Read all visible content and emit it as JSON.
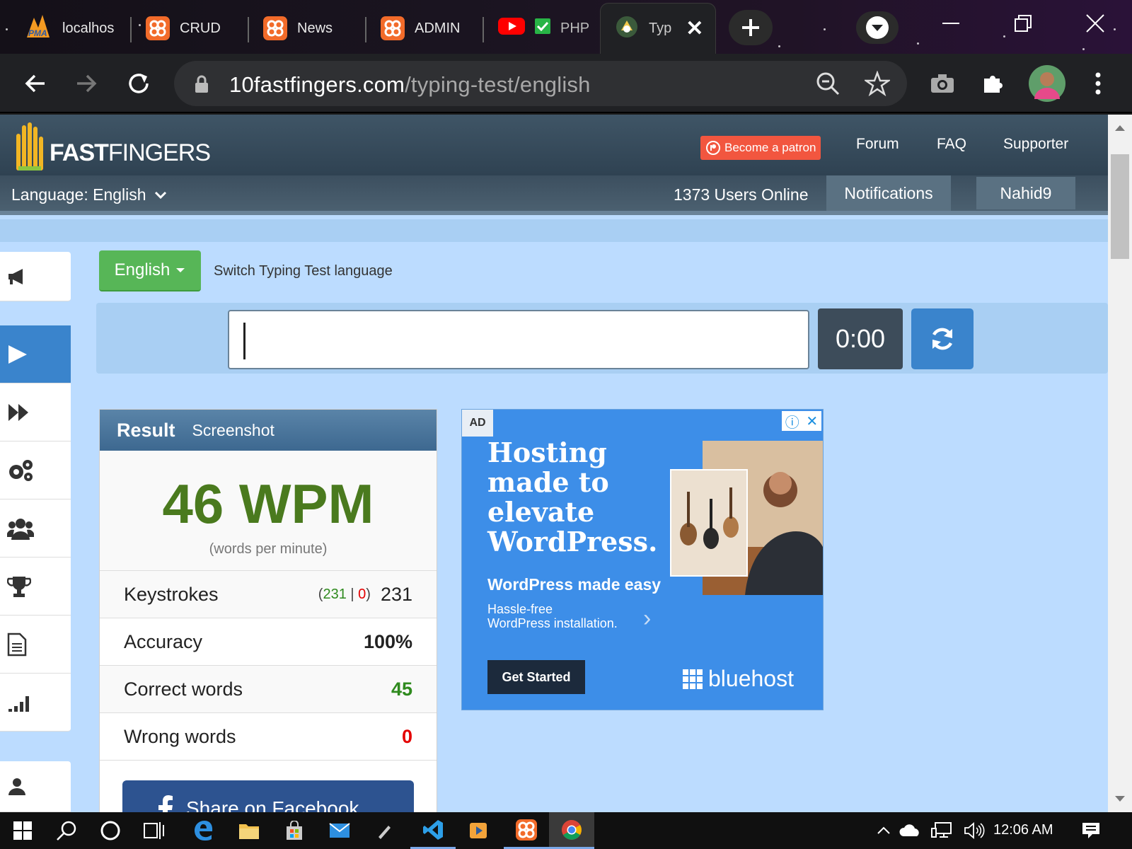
{
  "browser": {
    "tabs": [
      {
        "label": "localhos",
        "icon": "phpmyadmin-icon"
      },
      {
        "label": "CRUD",
        "icon": "xampp-icon"
      },
      {
        "label": "News",
        "icon": "xampp-icon"
      },
      {
        "label": "ADMIN",
        "icon": "xampp-icon"
      },
      {
        "label": "PHP",
        "icon": "youtube-icon"
      },
      {
        "label": "Typ",
        "icon": "site-icon"
      }
    ],
    "url_domain": "10fastfingers.com",
    "url_path": "/typing-test/english"
  },
  "site": {
    "logo_bold": "FAST",
    "logo_thin": "FINGERS",
    "patron_label": "Become a patron",
    "nav": {
      "forum": "Forum",
      "faq": "FAQ",
      "supporter": "Supporter"
    },
    "language_label": "Language: English",
    "users_online": "1373 Users Online",
    "notifications": "Notifications",
    "username": "Nahid9"
  },
  "test": {
    "language_button": "English",
    "switch_text": "Switch Typing Test language",
    "timer": "0:00"
  },
  "result": {
    "tab_result": "Result",
    "tab_screenshot": "Screenshot",
    "wpm": "46 WPM",
    "wpm_sub": "(words per minute)",
    "keystrokes_label": "Keystrokes",
    "keystrokes_correct": "231",
    "keystrokes_wrong": "0",
    "keystrokes_total": "231",
    "accuracy_label": "Accuracy",
    "accuracy_value": "100%",
    "correct_label": "Correct words",
    "correct_value": "45",
    "wrong_label": "Wrong words",
    "wrong_value": "0",
    "share_label": "Share on Facebook"
  },
  "ad": {
    "label": "AD",
    "headline": "Hosting made to elevate WordPress.",
    "subhead": "WordPress made easy",
    "desc_line1": "Hassle-free",
    "desc_line2": "WordPress installation.",
    "cta": "Get Started",
    "brand": "bluehost"
  },
  "taskbar": {
    "clock": "12:06 AM"
  },
  "colors": {
    "wpm_green": "#4a7a1e",
    "accent_blue": "#3a84cc",
    "language_green": "#57b657",
    "patron_red": "#f2563f",
    "ad_blue": "#3d8ee8"
  }
}
